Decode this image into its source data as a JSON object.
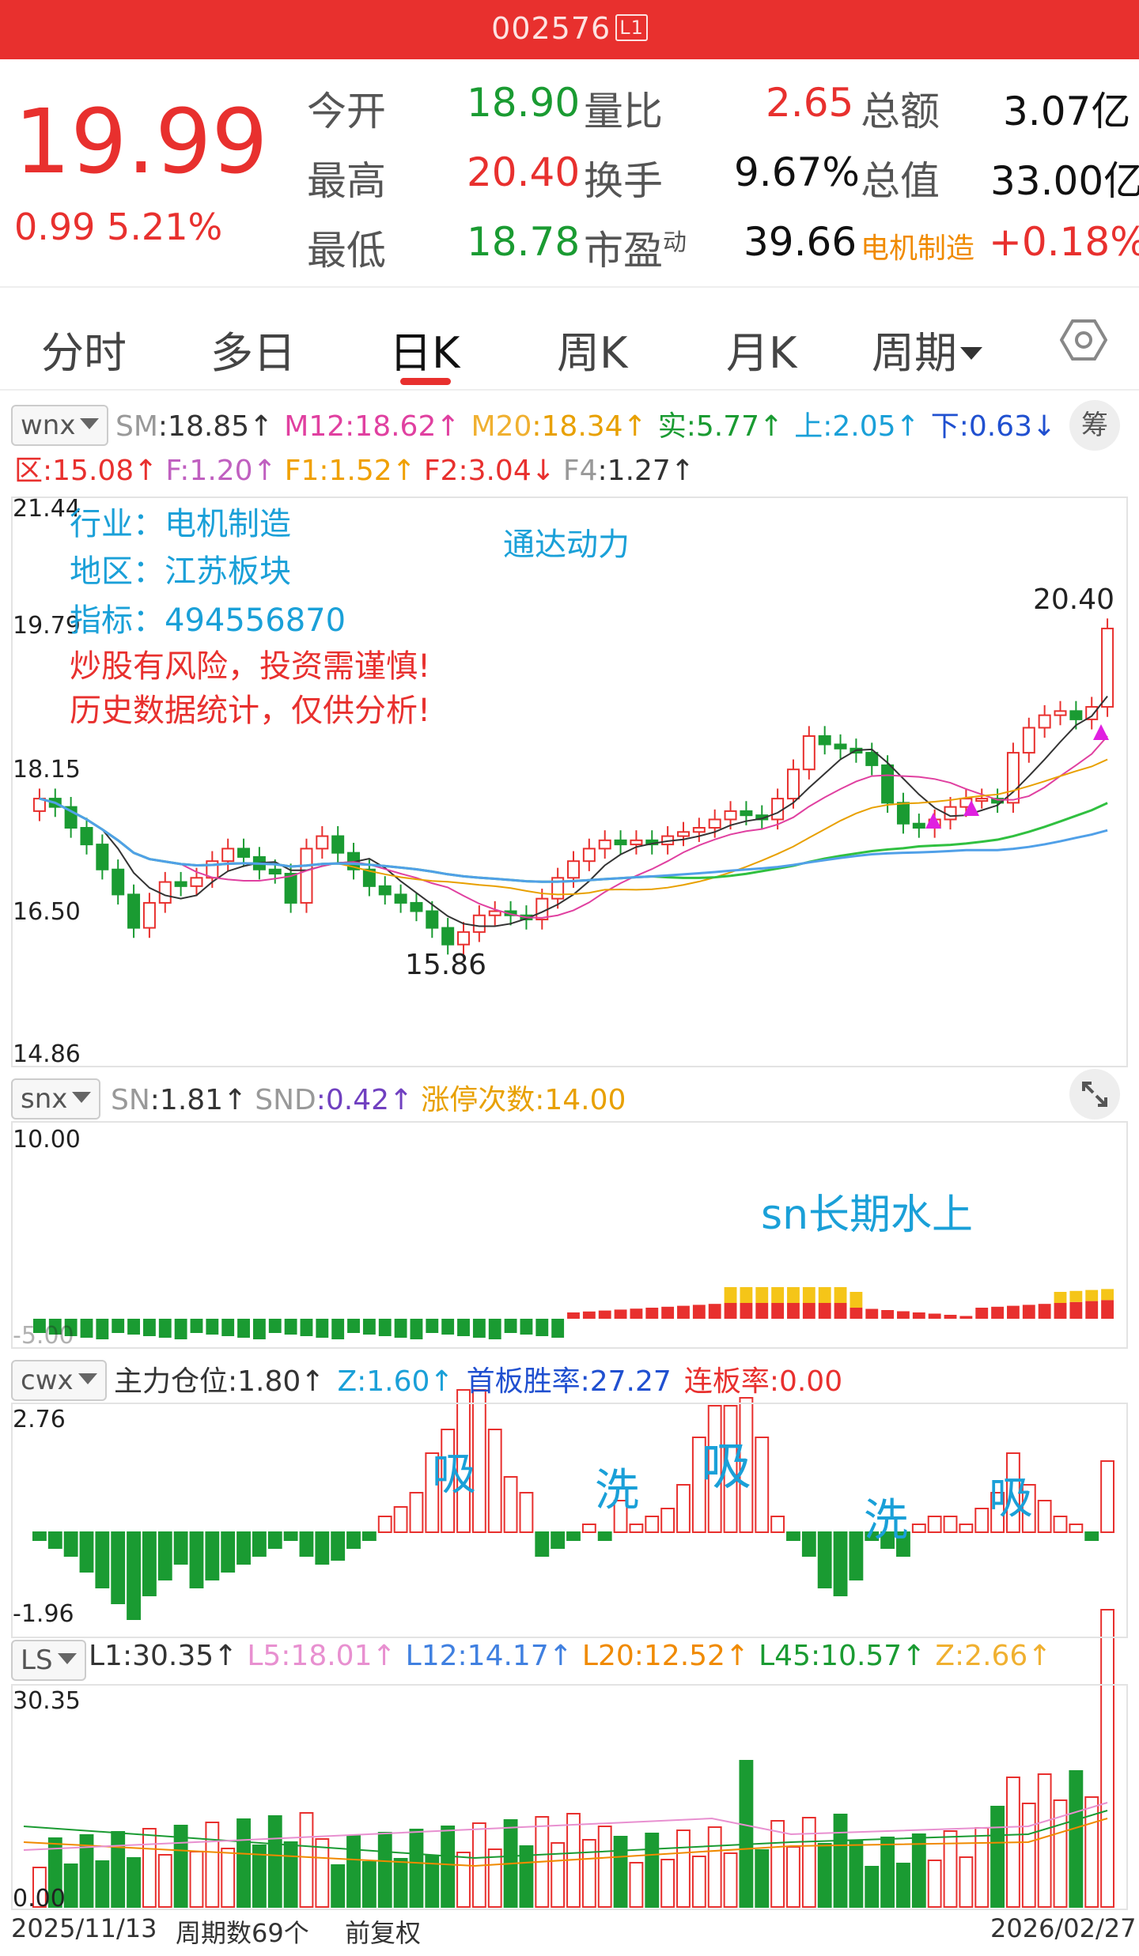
{
  "header": {
    "code": "002576",
    "level": "L1"
  },
  "quote": {
    "price": "19.99",
    "change": "0.99",
    "change_pct": "5.21%",
    "open_label": "今开",
    "open": "18.90",
    "high_label": "最高",
    "high": "20.40",
    "low_label": "最低",
    "low": "18.78",
    "vr_label": "量比",
    "vr": "2.65",
    "turnover_label": "换手",
    "turnover": "9.67%",
    "pe_label": "市盈",
    "pe_sup": "动",
    "pe": "39.66",
    "amount_label": "总额",
    "amount": "3.07亿",
    "mcap_label": "总值",
    "mcap": "33.00亿",
    "sector": "电机制造",
    "sector_chg": "+0.18%"
  },
  "tabs": [
    "分时",
    "多日",
    "日K",
    "周K",
    "月K",
    "周期"
  ],
  "active_tab": "日K",
  "kline": {
    "selector": "wnx",
    "row1": [
      {
        "k": "SM",
        "v": ":18.85↑",
        "kc": "#999",
        "vc": "#333"
      },
      {
        "k": "M12",
        "v": ":18.62↑",
        "kc": "#e040a0",
        "vc": "#e040a0"
      },
      {
        "k": "M20",
        "v": ":18.34↑",
        "kc": "#f0b030",
        "vc": "#e8a000"
      },
      {
        "k": "实",
        "v": ":5.77↑",
        "kc": "#1a9b32",
        "vc": "#1a9b32"
      },
      {
        "k": "上",
        "v": ":2.05↑",
        "kc": "#1aa0d8",
        "vc": "#1aa0d8"
      },
      {
        "k": "下",
        "v": ":0.63↓",
        "kc": "#2050d0",
        "vc": "#2050d0"
      }
    ],
    "row2": [
      {
        "k": "区",
        "v": ":15.08↑",
        "kc": "#e8302e",
        "vc": "#e8302e"
      },
      {
        "k": "F",
        "v": ":1.20↑",
        "kc": "#c060c0",
        "vc": "#c060c0"
      },
      {
        "k": "F1",
        "v": ":1.52↑",
        "kc": "#f0a000",
        "vc": "#f0a000"
      },
      {
        "k": "F2",
        "v": ":3.04↓",
        "kc": "#e8302e",
        "vc": "#e8302e"
      },
      {
        "k": "F4",
        "v": ":1.27↑",
        "kc": "#999",
        "vc": "#333"
      }
    ],
    "chip_btn": "筹",
    "axis": [
      "21.44",
      "19.79",
      "18.15",
      "16.50",
      "14.86"
    ],
    "info_industry": "行业：电机制造",
    "info_region": "地区：江苏板块",
    "info_index": "指标：494556870",
    "name": "通达动力",
    "warn1": "炒股有风险，投资需谨慎!",
    "warn2": "历史数据统计，仅供分析!",
    "max_label": "20.40",
    "min_label": "15.86"
  },
  "snx": {
    "selector": "snx",
    "inds": [
      {
        "k": "SN",
        "v": ":1.81↑",
        "kc": "#999",
        "vc": "#333"
      },
      {
        "k": "SND",
        "v": ":0.42↑",
        "kc": "#999",
        "vc": "#7040c0"
      },
      {
        "k": "涨停次数",
        "v": ":14.00",
        "kc": "#e8a000",
        "vc": "#e8a000"
      }
    ],
    "axis_top": "10.00",
    "axis_bottom": "-5.00",
    "note": "sn长期水上"
  },
  "cwx": {
    "selector": "cwx",
    "inds": [
      {
        "k": "主力仓位",
        "v": ":1.80↑",
        "kc": "#333",
        "vc": "#333"
      },
      {
        "k": "Z",
        "v": ":1.60↑",
        "kc": "#1aa0d8",
        "vc": "#1aa0d8"
      },
      {
        "k": "首板胜率",
        "v": ":27.27",
        "kc": "#2050d0",
        "vc": "#2050d0"
      },
      {
        "k": "连板率",
        "v": ":0.00",
        "kc": "#e8302e",
        "vc": "#e8302e"
      }
    ],
    "axis_top": "2.76",
    "axis_bottom": "-1.96",
    "labels": [
      "吸",
      "洗",
      "吸",
      "洗",
      "吸"
    ]
  },
  "ls": {
    "selector": "LS",
    "inds": [
      {
        "k": "L1",
        "v": ":30.35↑",
        "kc": "#333",
        "vc": "#333"
      },
      {
        "k": "L5",
        "v": ":18.01↑",
        "kc": "#e890d0",
        "vc": "#e890d0"
      },
      {
        "k": "L12",
        "v": ":14.17↑",
        "kc": "#4080e0",
        "vc": "#4080e0"
      },
      {
        "k": "L20",
        "v": ":12.52↑",
        "kc": "#f08a00",
        "vc": "#f08a00"
      },
      {
        "k": "L45",
        "v": ":10.57↑",
        "kc": "#1a9b32",
        "vc": "#1a9b32"
      },
      {
        "k": "Z",
        "v": ":2.66↑",
        "kc": "#f0b030",
        "vc": "#f0b030"
      }
    ],
    "axis_top": "30.35",
    "axis_bottom": "0.00"
  },
  "footer": {
    "start": "2025/11/13",
    "periods": "周期数69个",
    "adj": "前复权",
    "end": "2026/02/27"
  }
}
